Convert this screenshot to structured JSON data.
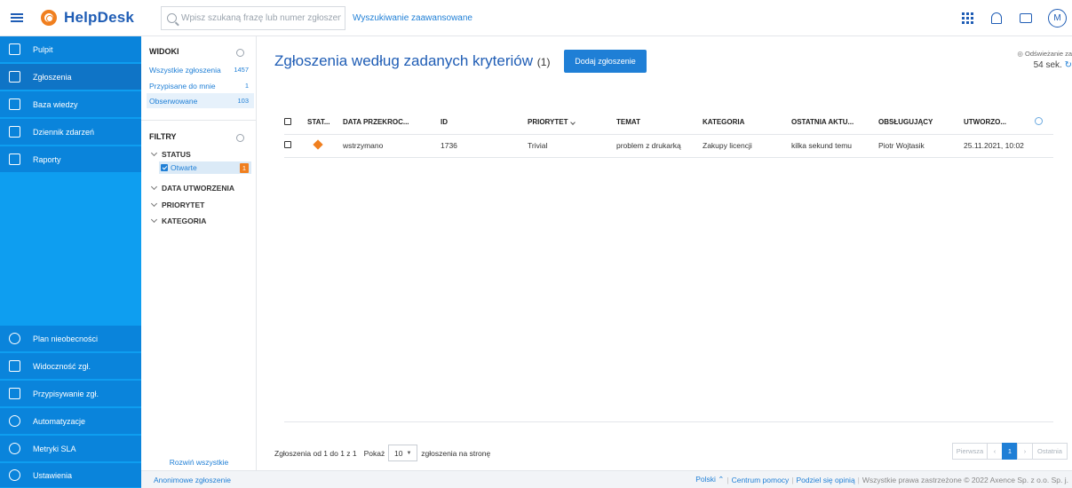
{
  "header": {
    "brand": "HelpDesk",
    "search_placeholder": "Wpisz szukaną frazę lub numer zgłoszenia",
    "advanced_search": "Wyszukiwanie zaawansowane",
    "avatar_initial": "M"
  },
  "sidebar": {
    "items": [
      {
        "label": "Pulpit",
        "icon": "dashboard-icon"
      },
      {
        "label": "Zgłoszenia",
        "icon": "tickets-icon"
      },
      {
        "label": "Baza wiedzy",
        "icon": "knowledge-base-icon"
      },
      {
        "label": "Dziennik zdarzeń",
        "icon": "event-log-icon"
      },
      {
        "label": "Raporty",
        "icon": "reports-icon"
      }
    ],
    "bottom_items": [
      {
        "label": "Plan nieobecności",
        "icon": "absence-plan-icon"
      },
      {
        "label": "Widoczność zgł.",
        "icon": "visibility-icon"
      },
      {
        "label": "Przypisywanie zgł.",
        "icon": "assignment-icon"
      },
      {
        "label": "Automatyzacje",
        "icon": "automation-icon"
      },
      {
        "label": "Metryki SLA",
        "icon": "sla-metrics-icon"
      },
      {
        "label": "Ustawienia",
        "icon": "settings-icon"
      }
    ]
  },
  "panel": {
    "views_title": "WIDOKI",
    "views": [
      {
        "label": "Wszystkie zgłoszenia",
        "count": "1457"
      },
      {
        "label": "Przypisane do mnie",
        "count": "1"
      },
      {
        "label": "Obserwowane",
        "count": "103"
      }
    ],
    "filters_title": "FILTRY",
    "filters": {
      "status": "STATUS",
      "status_chip": "Otwarte",
      "status_chip_count": "1",
      "created": "DATA UTWORZENIA",
      "priority": "PRIORYTET",
      "category": "KATEGORIA"
    },
    "expand_all": "Rozwiń wszystkie"
  },
  "main": {
    "title": "Zgłoszenia według zadanych kryteriów",
    "title_count": "(1)",
    "add_button": "Dodaj zgłoszenie",
    "refresh_label": "Odświeżanie za",
    "refresh_value": "54 sek.",
    "columns": [
      "STAT...",
      "DATA PRZEKROC...",
      "ID",
      "PRIORYTET",
      "TEMAT",
      "KATEGORIA",
      "OSTATNIA AKTU...",
      "OBSŁUGUJĄCY",
      "UTWORZO..."
    ],
    "rows": [
      {
        "due": "wstrzymano",
        "id": "1736",
        "priority": "Trivial",
        "subject": "problem z drukarką",
        "category": "Zakupy licencji",
        "last_activity": "kilka sekund temu",
        "assignee": "Piotr Wojtasik",
        "created": "25.11.2021, 10:02"
      }
    ],
    "pager": {
      "info": "Zgłoszenia od 1 do 1 z 1",
      "show": "Pokaż",
      "per_page": "10",
      "per_page_suffix": "zgłoszenia na stronę",
      "first": "Pierwsza",
      "prev": "‹",
      "current": "1",
      "next": "›",
      "last": "Ostatnia"
    }
  },
  "footer": {
    "anonymous": "Anonimowe zgłoszenie",
    "language": "Polski ⌃",
    "help_center": "Centrum pomocy",
    "feedback": "Podziel się opinią",
    "copyright": "Wszystkie prawa zastrzeżone © 2022 Axence Sp. z o.o. Sp. j."
  },
  "colors": {
    "sidebar": "#0e9ef0",
    "sidebar_item": "#0a84db",
    "primary": "#1f7fd6",
    "accent": "#f07f1f"
  }
}
